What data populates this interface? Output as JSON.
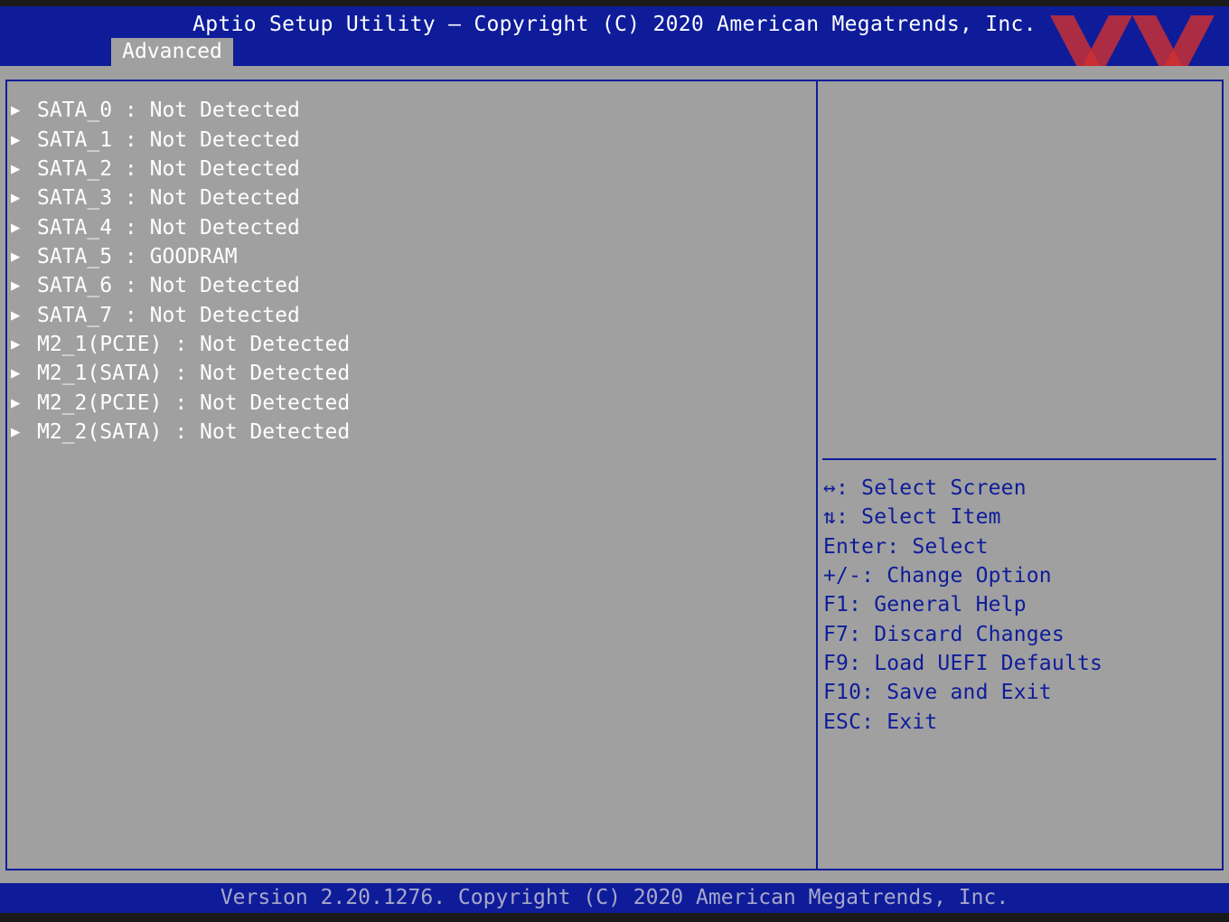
{
  "header": {
    "title": "Aptio Setup Utility – Copyright (C) 2020 American Megatrends, Inc.",
    "tab": "Advanced"
  },
  "logo": {
    "icon": "xx-logo-icon",
    "color": "#d03030"
  },
  "colors": {
    "bar": "#0e1c9a",
    "panel": "#a0a0a0",
    "text": "#ffffff"
  },
  "menu": {
    "marker_icon": "triangle-right-icon",
    "items": [
      "SATA_0 : Not Detected",
      "SATA_1 : Not Detected",
      "SATA_2 : Not Detected",
      "SATA_3 : Not Detected",
      "SATA_4 : Not Detected",
      "SATA_5 : GOODRAM",
      "SATA_6 : Not Detected",
      "SATA_7 : Not Detected",
      "M2_1(PCIE) : Not Detected",
      "M2_1(SATA) : Not Detected",
      "M2_2(PCIE) : Not Detected",
      "M2_2(SATA) : Not Detected"
    ]
  },
  "help": {
    "lines": [
      "↔: Select Screen",
      "⇅: Select Item",
      "Enter: Select",
      "+/-: Change Option",
      "F1: General Help",
      "F7: Discard Changes",
      "F9: Load UEFI Defaults",
      "F10: Save and Exit",
      "ESC: Exit"
    ]
  },
  "footer": {
    "version": "Version 2.20.1276. Copyright (C) 2020 American Megatrends, Inc."
  }
}
